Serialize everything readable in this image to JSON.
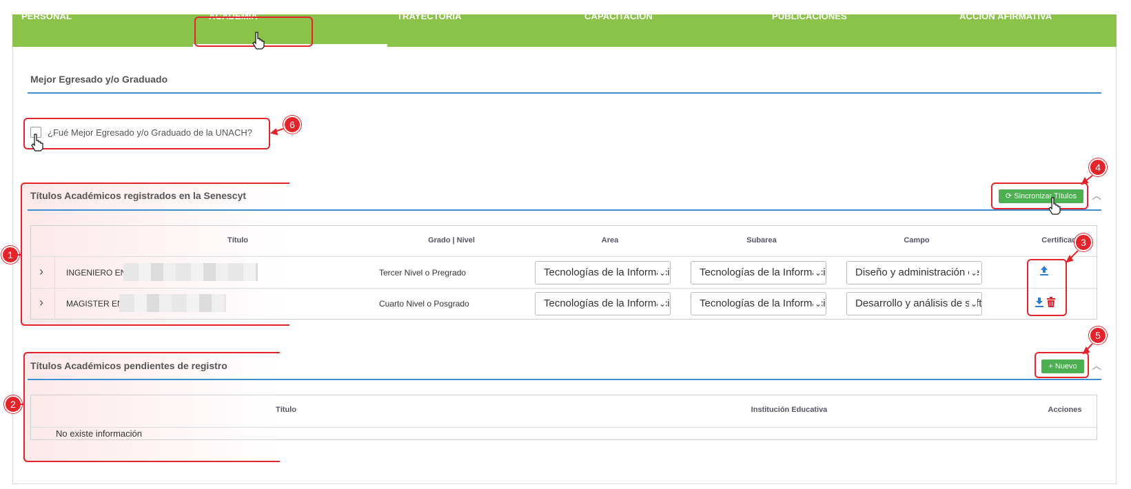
{
  "tabs": [
    {
      "label": "PERSONAL"
    },
    {
      "label": "ACADEMIA"
    },
    {
      "label": "TRAYECTORIA"
    },
    {
      "label": "CAPACITACIÓN"
    },
    {
      "label": "PUBLICACIONES"
    },
    {
      "label": "ACCIÓN AFIRMATIVA"
    }
  ],
  "best_graduate": {
    "section_title": "Mejor Egresado y/o Graduado",
    "checkbox_label": "¿Fué Mejor Egresado y/o Graduado de la UNACH?",
    "checked": false
  },
  "registered": {
    "section_title": "Títulos Académicos registrados en la Senescyt",
    "sync_button": "Sincronizar Títulos",
    "columns": [
      "Título",
      "Grado | Nivel",
      "Area",
      "Subarea",
      "Campo",
      "Certificado"
    ],
    "rows": [
      {
        "expand": "›",
        "title": "INGENIERO EN",
        "level": "Tercer Nivel o Pregrado",
        "area": "Tecnologías de la Información",
        "subarea": "Tecnologías de la Información",
        "campo": "Diseño y administración de"
      },
      {
        "expand": "›",
        "title": "MAGISTER EN",
        "level": "Cuarto Nivel o Posgrado",
        "area": "Tecnologías de la Información",
        "subarea": "Tecnologías de la Información",
        "campo": "Desarrollo y análisis de software"
      }
    ]
  },
  "pending": {
    "section_title": "Títulos Académicos pendientes de registro",
    "new_button": "Nuevo",
    "columns": [
      "Título",
      "Institución Educativa",
      "Acciones"
    ],
    "empty_text": "No existe información"
  },
  "annotations": [
    "1",
    "2",
    "3",
    "4",
    "5",
    "6"
  ],
  "colors": {
    "tab_bg": "#8bc34a",
    "accent_blue": "#3b8fd6",
    "button_green": "#4caf50",
    "annotation_red": "#e5232a"
  }
}
